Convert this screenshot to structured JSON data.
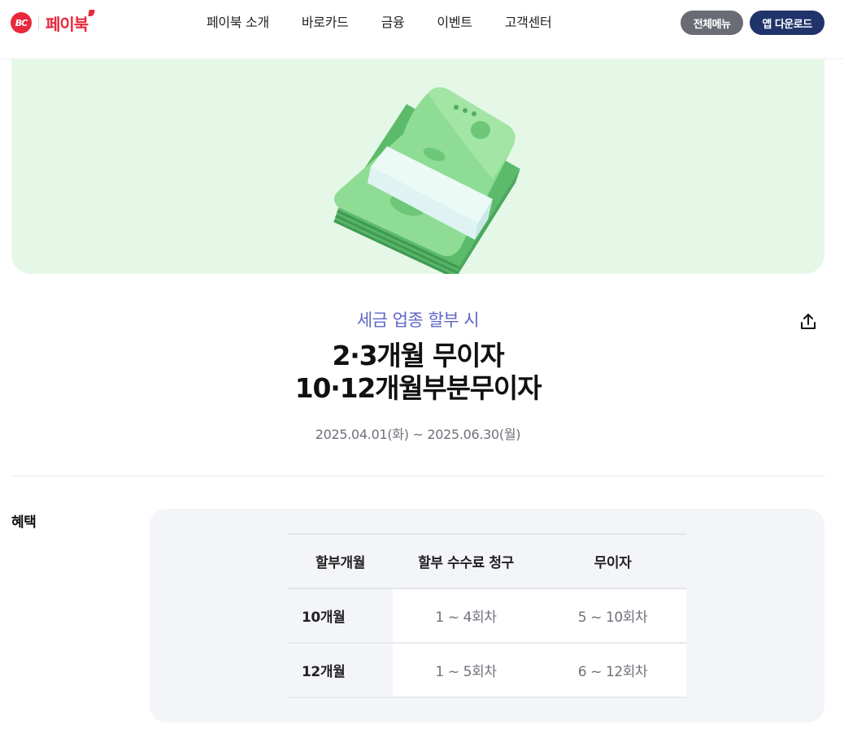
{
  "header": {
    "logo_bc": "BC",
    "logo_text": "페이북",
    "nav": [
      "페이북 소개",
      "바로카드",
      "금융",
      "이벤트",
      "고객센터"
    ],
    "menu_button": "전체메뉴",
    "app_button": "앱 다운로드",
    "brand_color": "#e8283c",
    "app_button_color": "#20336b"
  },
  "event": {
    "subtitle": "세금 업종 할부 시",
    "title_line1": "2·3개월 무이자",
    "title_line2": "10·12개월부분무이자",
    "period": "2025.04.01(화) ~ 2025.06.30(월)",
    "share_icon": "share-icon",
    "subtitle_color": "#5f67c6"
  },
  "benefit": {
    "label": "혜택",
    "table": {
      "headers": [
        "할부개월",
        "할부 수수료 청구",
        "무이자"
      ],
      "rows": [
        [
          "10개월",
          "1 ~ 4회차",
          "5 ~ 10회차"
        ],
        [
          "12개월",
          "1 ~ 5회차",
          "6 ~ 12회차"
        ]
      ]
    }
  }
}
